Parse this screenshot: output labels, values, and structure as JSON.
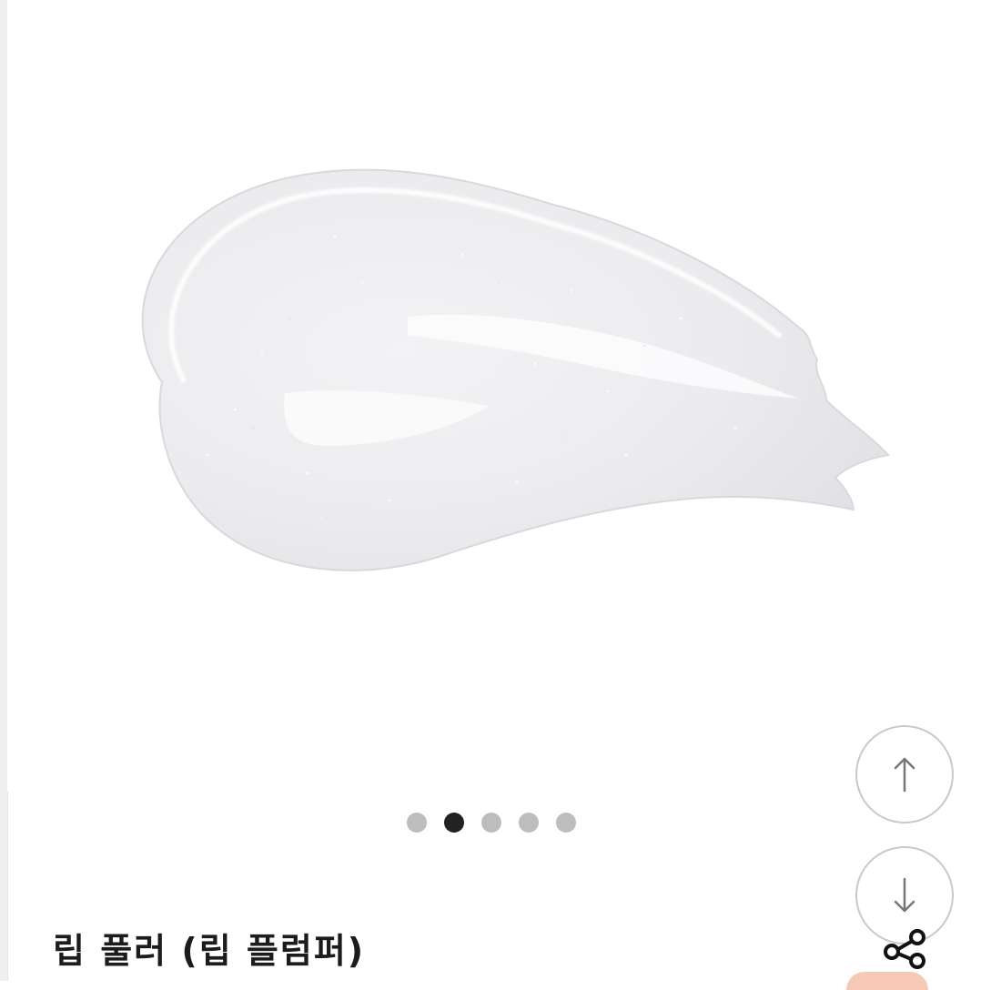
{
  "product": {
    "title": "립 풀러 (립 플럼퍼)"
  },
  "image": {
    "description_icon": "lip-gloss-swatch-image",
    "background_color": "#ffffff"
  },
  "carousel": {
    "total": 5,
    "active_index": 1,
    "active_color": "#222222",
    "inactive_color": "#bdbdbd"
  },
  "controls": {
    "scroll_up_icon": "arrow-up-icon",
    "scroll_down_icon": "arrow-down-icon",
    "share_icon": "share-icon"
  }
}
